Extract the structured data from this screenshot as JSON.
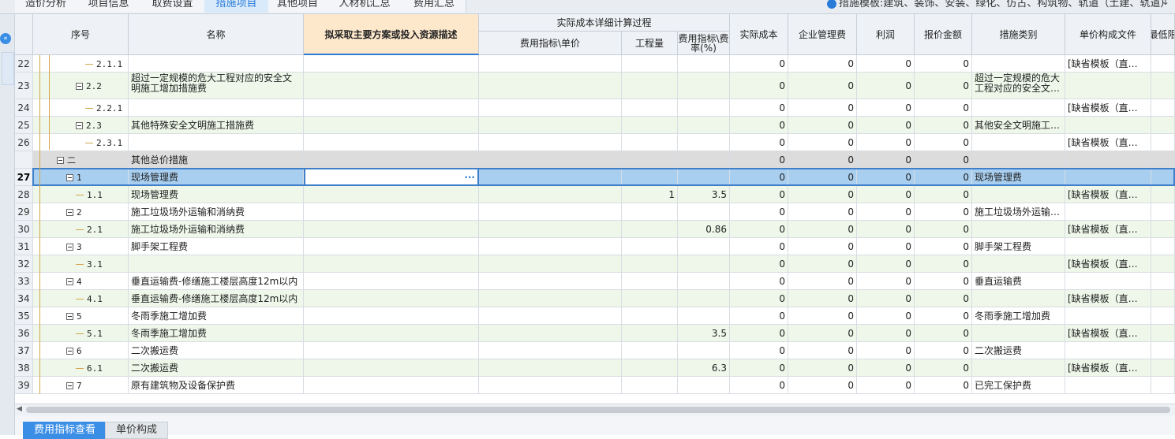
{
  "top_tabs": [
    {
      "label": "造价分析",
      "active": false
    },
    {
      "label": "项目信息",
      "active": false
    },
    {
      "label": "取费设置",
      "active": false
    },
    {
      "label": "措施项目",
      "active": true
    },
    {
      "label": "其他项目",
      "active": false
    },
    {
      "label": "人材机汇总",
      "active": false
    },
    {
      "label": "费用汇总",
      "active": false
    }
  ],
  "template_info": "措施模板:建筑、装饰、安装、绿化、仿古、构筑物、轨道（土建、轨道）",
  "headers": {
    "seq": "序号",
    "name": "名称",
    "plan": "拟采取主要方案或投入资源描述",
    "actual_detail": "实际成本详细计算过程",
    "fee_index_unit": "费用指标\\单价",
    "quantity": "工程量",
    "fee_rate": "费用指标\\费率(%)",
    "actual_cost": "实际成本",
    "mgmt_fee": "企业管理费",
    "profit": "利润",
    "quote": "报价金额",
    "category": "措施类别",
    "unit_price_file": "单价构成文件",
    "min": "最低限"
  },
  "rows": [
    {
      "rn": "22",
      "level": 3,
      "toggle": false,
      "seq": "2.1.1",
      "name": "",
      "quantity": "",
      "rate": "",
      "actual": "0",
      "mgmt": "0",
      "profit": "0",
      "quote": "0",
      "category": "",
      "file": "[缺省模板（直…"
    },
    {
      "rn": "23",
      "level": 2,
      "toggle": true,
      "seq": "2.2",
      "name": "超过一定规模的危大工程对应的安全文明施工增加措施费",
      "quantity": "",
      "rate": "",
      "actual": "0",
      "mgmt": "0",
      "profit": "0",
      "quote": "0",
      "category": "超过一定规模的危大工程对应的安全文…",
      "file": ""
    },
    {
      "rn": "24",
      "level": 3,
      "toggle": false,
      "seq": "2.2.1",
      "name": "",
      "quantity": "",
      "rate": "",
      "actual": "0",
      "mgmt": "0",
      "profit": "0",
      "quote": "0",
      "category": "",
      "file": "[缺省模板（直…"
    },
    {
      "rn": "25",
      "level": 2,
      "toggle": true,
      "seq": "2.3",
      "name": "其他特殊安全文明施工措施费",
      "quantity": "",
      "rate": "",
      "actual": "0",
      "mgmt": "0",
      "profit": "0",
      "quote": "0",
      "category": "其他安全文明施工…",
      "file": ""
    },
    {
      "rn": "26",
      "level": 3,
      "toggle": false,
      "seq": "2.3.1",
      "name": "",
      "quantity": "",
      "rate": "",
      "actual": "0",
      "mgmt": "0",
      "profit": "0",
      "quote": "0",
      "category": "",
      "file": "[缺省模板（直…"
    },
    {
      "rn": "",
      "level": 0,
      "toggle": true,
      "seq": "二",
      "name": "其他总价措施",
      "quantity": "",
      "rate": "",
      "actual": "0",
      "mgmt": "0",
      "profit": "0",
      "quote": "0",
      "category": "",
      "file": "",
      "group": true
    },
    {
      "rn": "27",
      "level": 1,
      "toggle": true,
      "seq": "1",
      "name": "现场管理费",
      "quantity": "",
      "rate": "",
      "actual": "0",
      "mgmt": "0",
      "profit": "0",
      "quote": "0",
      "category": "现场管理费",
      "file": "",
      "selected": true
    },
    {
      "rn": "28",
      "level": 2,
      "toggle": false,
      "seq": "1.1",
      "name": "现场管理费",
      "quantity": "1",
      "rate": "3.5",
      "actual": "0",
      "mgmt": "0",
      "profit": "0",
      "quote": "0",
      "category": "",
      "file": "[缺省模板（直…"
    },
    {
      "rn": "29",
      "level": 1,
      "toggle": true,
      "seq": "2",
      "name": "施工垃圾场外运输和消纳费",
      "quantity": "",
      "rate": "",
      "actual": "0",
      "mgmt": "0",
      "profit": "0",
      "quote": "0",
      "category": "施工垃圾场外运输…",
      "file": ""
    },
    {
      "rn": "30",
      "level": 2,
      "toggle": false,
      "seq": "2.1",
      "name": "施工垃圾场外运输和消纳费",
      "quantity": "",
      "rate": "0.86",
      "actual": "0",
      "mgmt": "0",
      "profit": "0",
      "quote": "0",
      "category": "",
      "file": "[缺省模板（直…"
    },
    {
      "rn": "31",
      "level": 1,
      "toggle": true,
      "seq": "3",
      "name": "脚手架工程费",
      "quantity": "",
      "rate": "",
      "actual": "0",
      "mgmt": "0",
      "profit": "0",
      "quote": "0",
      "category": "脚手架工程费",
      "file": ""
    },
    {
      "rn": "32",
      "level": 2,
      "toggle": false,
      "seq": "3.1",
      "name": "",
      "quantity": "",
      "rate": "",
      "actual": "0",
      "mgmt": "0",
      "profit": "0",
      "quote": "0",
      "category": "",
      "file": "[缺省模板（直…"
    },
    {
      "rn": "33",
      "level": 1,
      "toggle": true,
      "seq": "4",
      "name": "垂直运输费-修缮施工楼层高度12m以内",
      "quantity": "",
      "rate": "",
      "actual": "0",
      "mgmt": "0",
      "profit": "0",
      "quote": "0",
      "category": "垂直运输费",
      "file": ""
    },
    {
      "rn": "34",
      "level": 2,
      "toggle": false,
      "seq": "4.1",
      "name": "垂直运输费-修缮施工楼层高度12m以内",
      "quantity": "",
      "rate": "",
      "actual": "0",
      "mgmt": "0",
      "profit": "0",
      "quote": "0",
      "category": "",
      "file": "[缺省模板（直…"
    },
    {
      "rn": "35",
      "level": 1,
      "toggle": true,
      "seq": "5",
      "name": "冬雨季施工增加费",
      "quantity": "",
      "rate": "",
      "actual": "0",
      "mgmt": "0",
      "profit": "0",
      "quote": "0",
      "category": "冬雨季施工增加费",
      "file": ""
    },
    {
      "rn": "36",
      "level": 2,
      "toggle": false,
      "seq": "5.1",
      "name": "冬雨季施工增加费",
      "quantity": "",
      "rate": "3.5",
      "actual": "0",
      "mgmt": "0",
      "profit": "0",
      "quote": "0",
      "category": "",
      "file": "[缺省模板（直…"
    },
    {
      "rn": "37",
      "level": 1,
      "toggle": true,
      "seq": "6",
      "name": "二次搬运费",
      "quantity": "",
      "rate": "",
      "actual": "0",
      "mgmt": "0",
      "profit": "0",
      "quote": "0",
      "category": "二次搬运费",
      "file": ""
    },
    {
      "rn": "38",
      "level": 2,
      "toggle": false,
      "seq": "6.1",
      "name": "二次搬运费",
      "quantity": "",
      "rate": "6.3",
      "actual": "0",
      "mgmt": "0",
      "profit": "0",
      "quote": "0",
      "category": "",
      "file": "[缺省模板（直…"
    },
    {
      "rn": "39",
      "level": 1,
      "toggle": true,
      "seq": "7",
      "name": "原有建筑物及设备保护费",
      "quantity": "",
      "rate": "",
      "actual": "0",
      "mgmt": "0",
      "profit": "0",
      "quote": "0",
      "category": "已完工保护费",
      "file": ""
    }
  ],
  "selected_plan_ellipsis": "···",
  "bottom_tabs": [
    {
      "label": "费用指标查看",
      "active": true
    },
    {
      "label": "单价构成",
      "active": false
    }
  ],
  "colors": {
    "accent": "#2a7bd8",
    "row_even": "#ffffff",
    "row_odd": "#eef7e9",
    "row_group": "#dcdcdc",
    "row_selected": "#a9cff0",
    "plan_header": "#fde8cc",
    "tree_line": "#d4a64a"
  }
}
